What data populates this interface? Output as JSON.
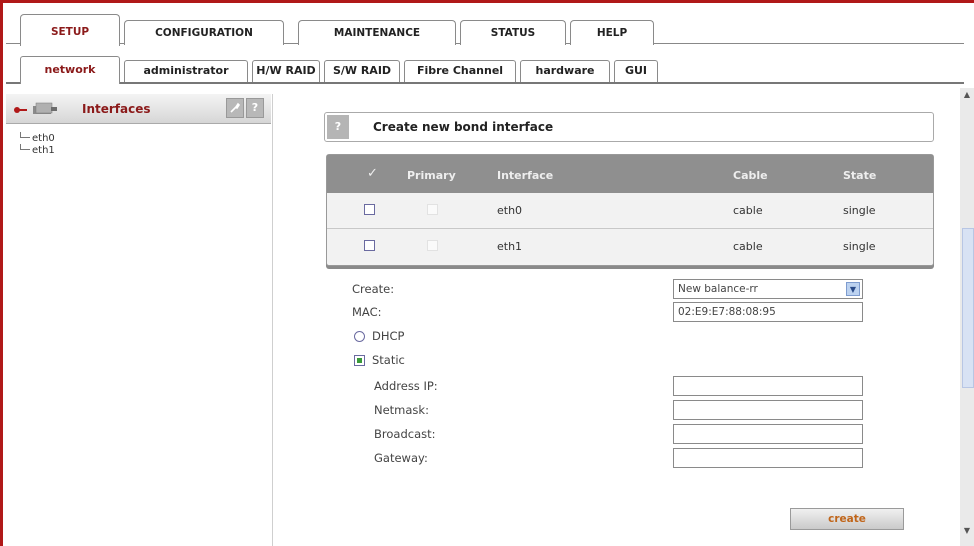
{
  "top_tabs": [
    "SETUP",
    "CONFIGURATION",
    "MAINTENANCE",
    "STATUS",
    "HELP"
  ],
  "sub_tabs": [
    "network",
    "administrator",
    "H/W RAID",
    "S/W RAID",
    "Fibre Channel",
    "hardware",
    "GUI"
  ],
  "left_panel": {
    "title": "Interfaces",
    "tree": [
      "eth0",
      "eth1"
    ],
    "help_label": "?"
  },
  "main": {
    "help_label": "?",
    "title": "Create new bond interface",
    "table": {
      "headers": [
        "✓",
        "Primary",
        "Interface",
        "Cable",
        "State"
      ],
      "rows": [
        {
          "interface": "eth0",
          "cable": "cable",
          "state": "single"
        },
        {
          "interface": "eth1",
          "cable": "cable",
          "state": "single"
        }
      ]
    },
    "form": {
      "create_label": "Create:",
      "create_value": "New balance-rr",
      "mac_label": "MAC:",
      "mac_value": "02:E9:E7:88:08:95",
      "dhcp_label": "DHCP",
      "static_label": "Static",
      "address_label": "Address IP:",
      "netmask_label": "Netmask:",
      "broadcast_label": "Broadcast:",
      "gateway_label": "Gateway:"
    },
    "create_button": "create"
  },
  "colors": {
    "accent_red": "#b01818",
    "table_header": "#8f8f8f",
    "button_text": "#c0651a"
  }
}
